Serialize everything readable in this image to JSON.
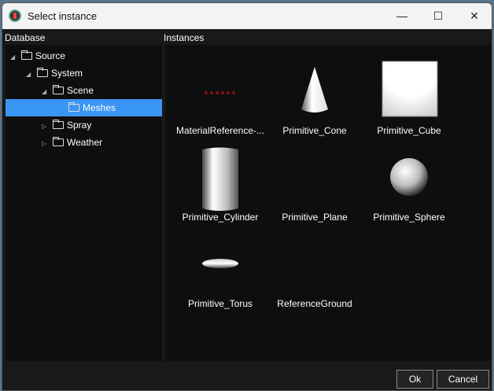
{
  "window": {
    "title": "Select instance",
    "minimize": "—",
    "maximize": "☐",
    "close": "✕"
  },
  "database": {
    "header": "Database",
    "tree": [
      {
        "label": "Source",
        "depth": 0,
        "arrow": "◢"
      },
      {
        "label": "System",
        "depth": 1,
        "arrow": "◢"
      },
      {
        "label": "Scene",
        "depth": 2,
        "arrow": "◢"
      },
      {
        "label": "Meshes",
        "depth": 3,
        "arrow": "",
        "selected": true
      },
      {
        "label": "Spray",
        "depth": 2,
        "arrow": "▷"
      },
      {
        "label": "Weather",
        "depth": 2,
        "arrow": "▷"
      }
    ]
  },
  "instances": {
    "header": "Instances",
    "items": [
      {
        "label": "MaterialReference-...",
        "shape": "dots"
      },
      {
        "label": "Primitive_Cone",
        "shape": "cone"
      },
      {
        "label": "Primitive_Cube",
        "shape": "cube"
      },
      {
        "label": "Primitive_Cylinder",
        "shape": "cylinder"
      },
      {
        "label": "Primitive_Plane",
        "shape": "none"
      },
      {
        "label": "Primitive_Sphere",
        "shape": "sphere"
      },
      {
        "label": "Primitive_Torus",
        "shape": "torus"
      },
      {
        "label": "ReferenceGround",
        "shape": "none"
      }
    ]
  },
  "buttons": {
    "ok": "Ok",
    "cancel": "Cancel"
  }
}
